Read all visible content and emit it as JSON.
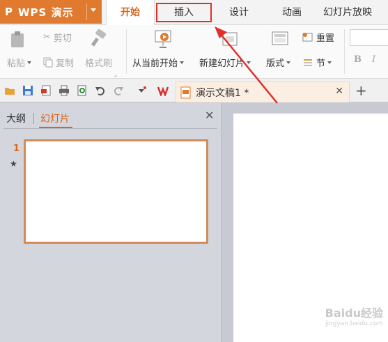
{
  "app": {
    "logo": "P",
    "name": "WPS 演示"
  },
  "tabs": [
    {
      "label": "开始"
    },
    {
      "label": "插入"
    },
    {
      "label": "设计"
    },
    {
      "label": "动画"
    },
    {
      "label": "幻灯片放映"
    }
  ],
  "ribbon": {
    "paste": "粘贴",
    "cut": "剪切",
    "copy": "复制",
    "format_painter": "格式刷",
    "from_current": "从当前开始",
    "new_slide": "新建幻灯片",
    "layout": "版式",
    "reset": "重置",
    "section": "节",
    "bold": "B",
    "italic": "I"
  },
  "document_tab": {
    "title": "演示文稿1 *"
  },
  "panel": {
    "outline_tab": "大纲",
    "slides_tab": "幻灯片",
    "slide_number": "1",
    "slide_star": "★"
  },
  "watermark": {
    "brand": "Baidu经验",
    "url": "jingyan.baidu.com"
  },
  "colors": {
    "accent": "#e07a2f",
    "active_tab_text": "#d9661e",
    "highlight_box": "#e0302c",
    "arrow": "#e0302c"
  }
}
